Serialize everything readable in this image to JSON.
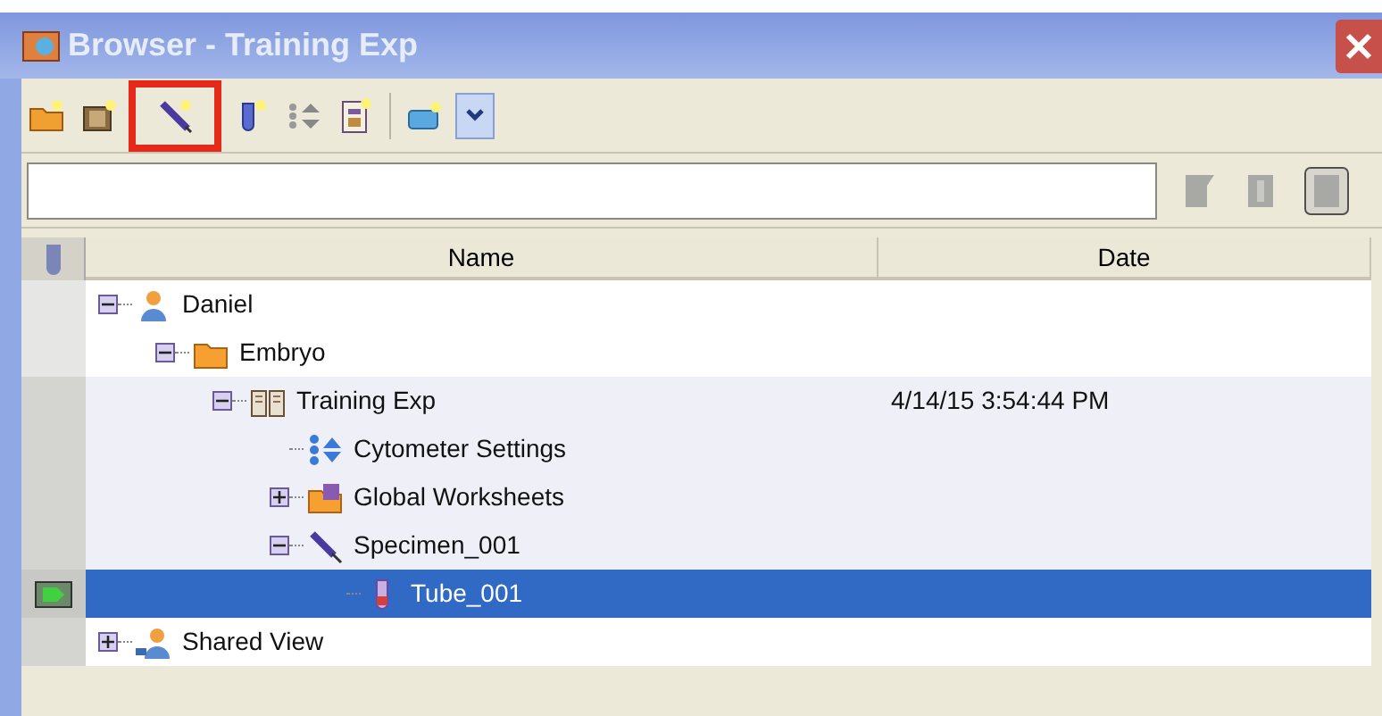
{
  "window": {
    "title": "Browser - Training Exp"
  },
  "toolbar": [
    {
      "highlighted": false
    },
    {
      "highlighted": false
    },
    {
      "highlighted": true
    },
    {
      "highlighted": false
    },
    {
      "highlighted": false
    },
    {
      "highlighted": false
    },
    {
      "highlighted": false
    },
    {
      "highlighted": false
    }
  ],
  "table": {
    "columns": [
      "Name",
      "Date"
    ],
    "tree": [
      {
        "label": "Daniel",
        "kind": "user",
        "expanded": true,
        "selected": false,
        "children": [
          {
            "label": "Embryo",
            "kind": "folder",
            "expanded": true,
            "selected": false,
            "children": [
              {
                "label": "Training Exp",
                "kind": "experiment",
                "date": "4/14/15 3:54:44 PM",
                "expanded": true,
                "selected": false,
                "current": true,
                "children": [
                  {
                    "label": "Cytometer Settings",
                    "kind": "settings",
                    "selected": false
                  },
                  {
                    "label": "Global Worksheets",
                    "kind": "worksheets",
                    "expanded": false,
                    "selected": false
                  },
                  {
                    "label": "Specimen_001",
                    "kind": "specimen",
                    "expanded": true,
                    "selected": false,
                    "children": [
                      {
                        "label": "Tube_001",
                        "kind": "tube",
                        "selected": true,
                        "acquiring": true
                      }
                    ]
                  }
                ]
              }
            ]
          }
        ]
      },
      {
        "label": "Shared View",
        "kind": "shared",
        "expanded": false,
        "selected": false
      }
    ]
  }
}
